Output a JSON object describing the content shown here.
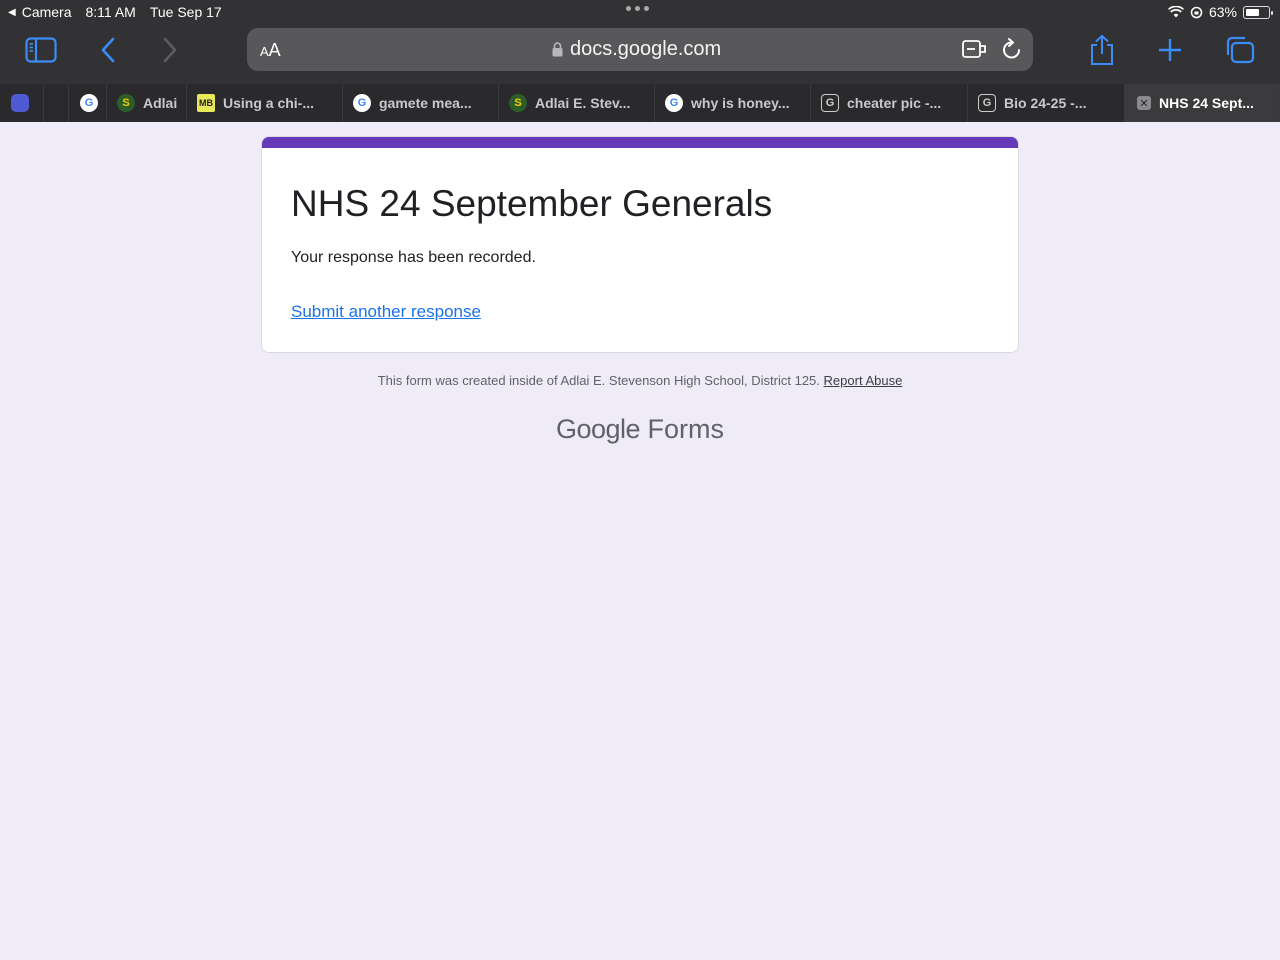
{
  "status_bar": {
    "back_app": "Camera",
    "time": "8:11 AM",
    "date": "Tue Sep 17",
    "battery": "63%",
    "battery_level": 0.63
  },
  "browser": {
    "url_text_size_label": "AA",
    "url": "docs.google.com",
    "tabs": [
      {
        "label": "",
        "favicon": "grouped-tabs-icon"
      },
      {
        "label": "",
        "favicon": "blank"
      },
      {
        "label": "",
        "favicon": "google-icon"
      },
      {
        "label": "Adlai",
        "favicon": "school-logo-icon"
      },
      {
        "label": "Using a chi-...",
        "favicon": "mb-icon"
      },
      {
        "label": "gamete mea...",
        "favicon": "google-icon"
      },
      {
        "label": "Adlai E. Stev...",
        "favicon": "school-logo-icon"
      },
      {
        "label": "why is honey...",
        "favicon": "google-icon"
      },
      {
        "label": "cheater pic -...",
        "favicon": "g-box-icon"
      },
      {
        "label": "Bio 24-25 -...",
        "favicon": "g-box-icon"
      },
      {
        "label": "NHS 24 Sept...",
        "favicon": "close-tab-icon"
      }
    ]
  },
  "form": {
    "title": "NHS 24 September Generals",
    "message": "Your response has been recorded.",
    "link": "Submit another response",
    "accent_color": "#673ab7"
  },
  "footer": {
    "notice": "This form was created inside of Adlai E. Stevenson High School, District 125.",
    "report_abuse": "Report Abuse",
    "brand_google": "Google",
    "brand_forms": "Forms"
  }
}
